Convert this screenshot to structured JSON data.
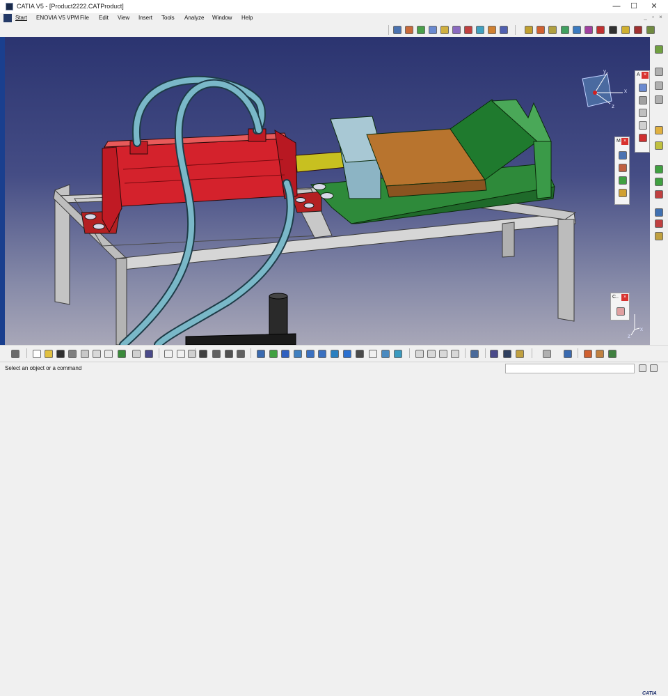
{
  "window": {
    "title": "CATIA V5 - [Product2222.CATProduct]",
    "minimize": "—",
    "maximize": "☐",
    "close": "✕"
  },
  "menubar": {
    "items": [
      "Start",
      "ENOVIA V5 VPM",
      "File",
      "Edit",
      "View",
      "Insert",
      "Tools",
      "Analyze",
      "Window",
      "Help"
    ],
    "mdi_minimize": "_",
    "mdi_restore": "▫",
    "mdi_close": "×"
  },
  "floating_toolbars": {
    "top": {
      "title": "A"
    },
    "middle": {
      "title": "M"
    },
    "bottom": {
      "title": "C.."
    }
  },
  "compass": {
    "x_label": "x",
    "y_label": "y",
    "z_label": "z"
  },
  "axis_triad": {
    "x_label": "x",
    "y_label": "y",
    "z_label": "z"
  },
  "statusbar": {
    "prompt": "Select an object or a command",
    "command_input": ""
  },
  "branding": {
    "logo_text": "CATIA"
  },
  "colors": {
    "viewport_top": "#2b3470",
    "viewport_bottom": "#a8a7b8",
    "cylinder": "#d0202a",
    "vise_base": "#2e8a3a",
    "jaw_block": "#b8742e",
    "hose": "#6aa8b8",
    "frame": "#b8b8b8"
  },
  "icons": {
    "top_toolbar": [
      "product-structure-icon",
      "assembly-icon",
      "constraint-icon",
      "snap-icon",
      "measure-icon",
      "clash-icon",
      "section-icon",
      "explode-icon",
      "catalog-icon",
      "component-icon",
      "insert-component-icon",
      "replace-icon",
      "graph-tree-icon",
      "reorder-icon",
      "multi-instantiate-icon",
      "manipulate-icon",
      "scene-icon",
      "publish-icon",
      "representation-icon"
    ],
    "bottom_toolbar": [
      "select-icon",
      "new-icon",
      "open-icon",
      "save-icon",
      "print-icon",
      "cut-icon",
      "copy-icon",
      "paste-icon",
      "undo-icon",
      "redo-icon",
      "whats-this-icon",
      "formula-icon",
      "knowledge-icon",
      "grid-icon",
      "fit-all-icon",
      "pan-icon",
      "rotate-icon",
      "zoom-in-icon",
      "zoom-out-icon",
      "normal-view-icon",
      "quick-view-icon",
      "render-style-icon",
      "hide-show-icon",
      "swap-space-icon",
      "update-icon",
      "analysis-icon"
    ],
    "right_strip": [
      "compass-icon",
      "new-product-icon",
      "new-part-icon",
      "existing-component-icon",
      "replace-component-icon",
      "graph-tree-reorder-icon",
      "generate-numbering-icon",
      "selective-load-icon",
      "manage-representations-icon"
    ]
  }
}
